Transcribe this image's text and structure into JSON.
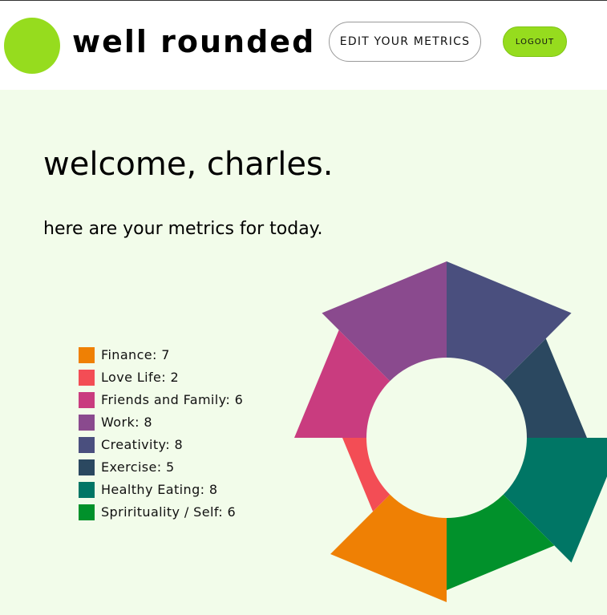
{
  "header": {
    "brand": "well rounded",
    "edit_metrics_label": "EDIT YOUR METRICS",
    "logout_label": "LOGOUT",
    "logo_color": "#96dc1e"
  },
  "main": {
    "greeting": "welcome, charles.",
    "subtitle": "here are your metrics for today."
  },
  "legend": {
    "items": [
      {
        "text": "Finance: 7"
      },
      {
        "text": "Love Life: 2"
      },
      {
        "text": "Friends and Family: 6"
      },
      {
        "text": "Work: 8"
      },
      {
        "text": "Creativity: 8"
      },
      {
        "text": "Exercise: 5"
      },
      {
        "text": "Healthy Eating: 8"
      },
      {
        "text": "Sprirituality / Self: 6"
      }
    ]
  },
  "chart_data": {
    "type": "pie",
    "variant": "donut",
    "max_value": 10,
    "start_angle_deg": 90,
    "direction": "clockwise",
    "slices": [
      {
        "label": "Finance",
        "value": 7,
        "color": "#ef8004"
      },
      {
        "label": "Love Life",
        "value": 2,
        "color": "#f34d55"
      },
      {
        "label": "Friends and Family",
        "value": 6,
        "color": "#c93c7f"
      },
      {
        "label": "Work",
        "value": 8,
        "color": "#8a4a8e"
      },
      {
        "label": "Creativity",
        "value": 8,
        "color": "#4a4f7e"
      },
      {
        "label": "Exercise",
        "value": 5,
        "color": "#2b4860"
      },
      {
        "label": "Healthy Eating",
        "value": 8,
        "color": "#007665"
      },
      {
        "label": "Sprirituality / Self",
        "value": 6,
        "color": "#01912b"
      }
    ]
  }
}
